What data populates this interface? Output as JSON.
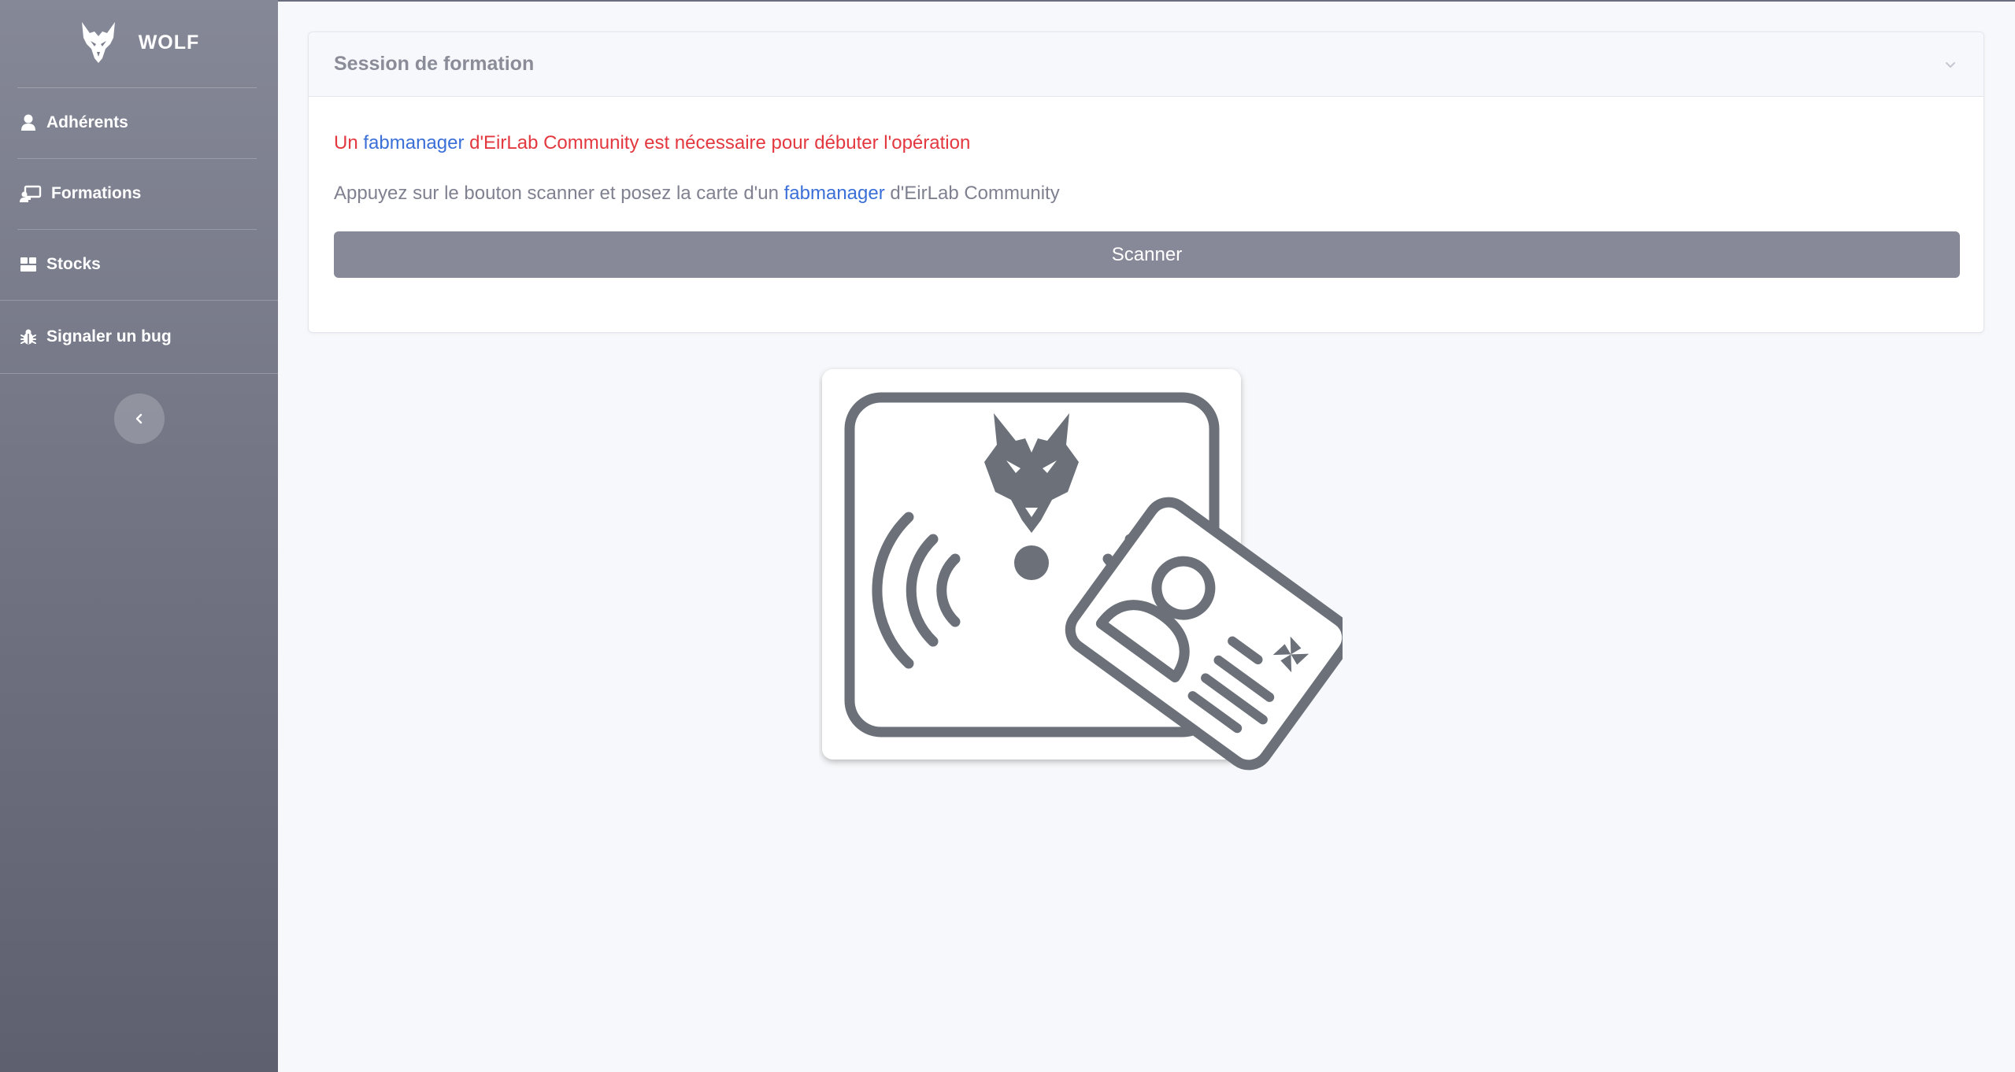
{
  "brand": {
    "name": "WOLF",
    "logo_icon": "wolf-head-icon"
  },
  "sidebar": {
    "items": [
      {
        "label": "Adhérents",
        "icon": "user-icon"
      },
      {
        "label": "Formations",
        "icon": "chalkboard-teacher-icon"
      },
      {
        "label": "Stocks",
        "icon": "boxes-icon"
      },
      {
        "label": "Signaler un bug",
        "icon": "bug-icon"
      }
    ],
    "collapse_icon": "chevron-left-icon"
  },
  "card": {
    "title": "Session de formation",
    "error": {
      "pre": "Un ",
      "link": "fabmanager",
      "post": " d'EirLab Community est nécessaire pour débuter l'opération"
    },
    "info": {
      "pre": "Appuyez sur le bouton scanner et posez la carte d'un ",
      "link": "fabmanager",
      "post": " d'EirLab Community"
    },
    "scan_button": "Scanner"
  },
  "colors": {
    "sidebar_top": "#858897",
    "sidebar_bottom": "#5e606f",
    "error_text": "#e3383f",
    "link": "#3b6fd8",
    "button": "#878999",
    "illustration": "#6b7079"
  },
  "illustration": {
    "icon": "nfc-badge-scan-icon"
  }
}
